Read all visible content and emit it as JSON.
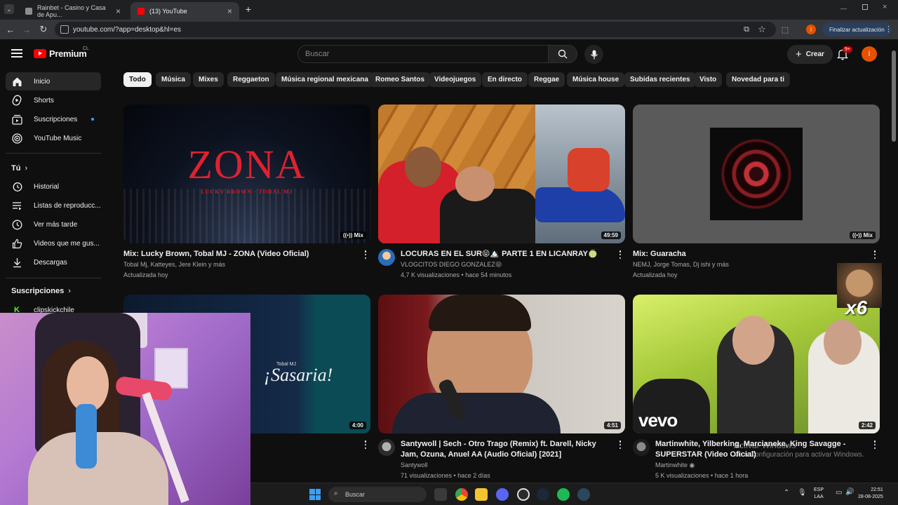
{
  "browser": {
    "tabs": [
      {
        "title": "Rainbet - Casino y Casa de Apu...",
        "favicon_color": "#8e8e8e"
      },
      {
        "title": "(13) YouTube",
        "favicon_color": "#ff0000"
      }
    ],
    "url": "youtube.com/?app=desktop&hl=es",
    "update_button": "Finalizar actualización",
    "profile_initial": "I"
  },
  "masthead": {
    "logo_text": "Premium",
    "logo_region": "CL",
    "search_placeholder": "Buscar",
    "create_label": "Crear",
    "notification_count": "9+",
    "avatar_initial": "I"
  },
  "sidebar": {
    "main": [
      {
        "label": "Inicio",
        "icon": "home-icon",
        "active": true
      },
      {
        "label": "Shorts",
        "icon": "shorts-icon"
      },
      {
        "label": "Suscripciones",
        "icon": "subscriptions-icon",
        "dot": true
      },
      {
        "label": "YouTube Music",
        "icon": "youtube-music-icon"
      }
    ],
    "you_heading": "Tú",
    "you_items": [
      {
        "label": "Historial",
        "icon": "history-icon"
      },
      {
        "label": "Listas de reproducc...",
        "icon": "playlists-icon"
      },
      {
        "label": "Ver más tarde",
        "icon": "watch-later-icon"
      },
      {
        "label": "Videos que me gus...",
        "icon": "thumbs-up-icon"
      },
      {
        "label": "Descargas",
        "icon": "download-icon"
      }
    ],
    "subs_heading": "Suscripciones",
    "subs_items": [
      {
        "label": "clipskickchile",
        "icon": "kick-channel-icon"
      }
    ]
  },
  "chips": [
    "Todo",
    "Música",
    "Mixes",
    "Reggaeton",
    "Música regional mexicana",
    "Romeo Santos",
    "Videojuegos",
    "En directo",
    "Reggae",
    "Música house",
    "Subidas recientes",
    "Visto",
    "Novedad para ti"
  ],
  "videos": [
    {
      "title": "Mix: Lucky Brown, Tobal MJ - ZONA (Video Oficial)",
      "meta1": "Tobal Mj, Katteyes, Jere Klein y más",
      "meta2": "Actualizada hoy",
      "badge": "Mix",
      "thumb_text": "ZONA",
      "thumb_sub": "LUCKY BROWN · TOBAL MJ"
    },
    {
      "title": "LOCURAS EN EL SUR😝🏔️ PARTE 1 EN LICANRAY🍈",
      "meta1": "VLOGCITOS DIEGO GONZALEZ😝",
      "meta2": "4,7 K visualizaciones • hace 54 minutos",
      "duration": "49:59"
    },
    {
      "title": "Mix: Guaracha",
      "meta1": "NEMJ, Jorge Tomas, Dj ishi y más",
      "meta2": "Actualizada hoy",
      "badge": "Mix"
    },
    {
      "title": "",
      "meta1": "",
      "meta2": "",
      "duration": "4:00",
      "thumb_text": "¡Sasaria!",
      "thumb_sub": "Tobal MJ"
    },
    {
      "title": "Santywoll | Sech - Otro Trago (Remix) ft. Darell, Nicky Jam, Ozuna, Anuel AA (Audio Oficial) [2021]",
      "meta1": "Santywoll",
      "meta2": "71 visualizaciones • hace 2 días",
      "duration": "4:51"
    },
    {
      "title": "Martinwhite, Yilberking, Marcianeke, King Savagge - SUPERSTAR (Video Oficial)",
      "meta1": "Martinwhite",
      "meta2": "5 K visualizaciones • hace 1 hora",
      "duration": "2:42",
      "thumb_text": "vevo",
      "corner_text": "x6"
    }
  ],
  "activation": {
    "line1": "Activar Windows",
    "line2": "Ve a Configuración para activar Windows."
  },
  "taskbar": {
    "search_placeholder": "Buscar",
    "lang1": "ESP",
    "lang2": "LAA",
    "time": "22:51",
    "date": "28-08-2025"
  }
}
